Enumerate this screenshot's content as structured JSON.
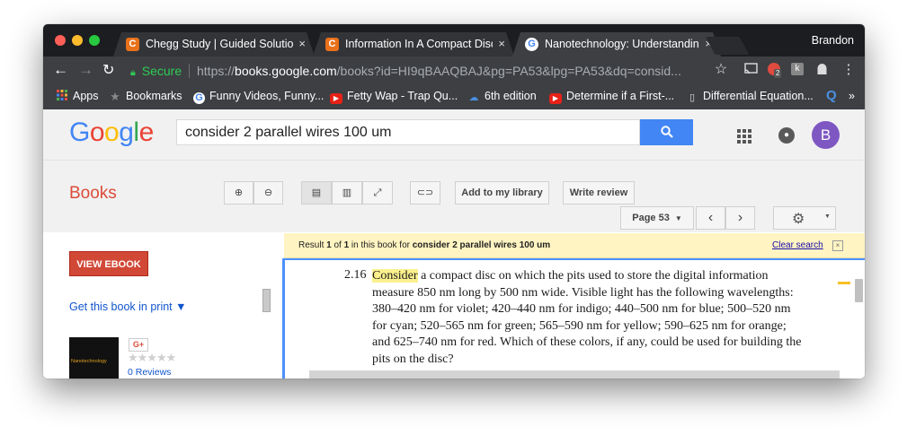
{
  "browser": {
    "tabs": [
      {
        "title": "Chegg Study | Guided Solution",
        "close": "×",
        "favicon": "C"
      },
      {
        "title": "Information In A Compact Disc",
        "close": "×",
        "favicon": "C"
      },
      {
        "title": "Nanotechnology: Understanding",
        "close": "×",
        "favicon": "G"
      }
    ],
    "profile": "Brandon",
    "secure_label": "Secure",
    "url_scheme": "https://",
    "url_host": "books.google.com",
    "url_path": "/books?id=HI9qBAAQBAJ&pg=PA53&lpg=PA53&dq=consid...",
    "icons": [
      "back-icon",
      "forward-icon",
      "reload-icon",
      "lock-icon",
      "star-icon",
      "cast-icon",
      "extension-icon",
      "extension-badge",
      "ghost-icon",
      "menu-icon"
    ],
    "extension_badge_count": "2",
    "bookmarks": [
      {
        "label": "Apps"
      },
      {
        "label": "Bookmarks"
      },
      {
        "label": "Funny Videos, Funny..."
      },
      {
        "label": "Fetty Wap - Trap Qu..."
      },
      {
        "label": "6th edition"
      },
      {
        "label": "Determine if a First-..."
      },
      {
        "label": "Differential Equation..."
      }
    ],
    "bookmarks_more": "»"
  },
  "google": {
    "logo_letters": [
      "G",
      "o",
      "o",
      "g",
      "l",
      "e"
    ],
    "logo_colors": [
      "#4285f4",
      "#ea4335",
      "#fbbc05",
      "#4285f4",
      "#34a853",
      "#ea4335"
    ],
    "search_query": "consider 2 parallel wires 100 um",
    "avatar_letter": "B"
  },
  "books": {
    "title": "Books",
    "add_library": "Add to my library",
    "write_review": "Write review",
    "page_label": "Page 53",
    "view_ebook": "VIEW EBOOK",
    "get_print": "Get this book in print ▼",
    "cover_text": "Nanotechnology",
    "gplus": "G+",
    "stars": "★★★★★",
    "rating": 0,
    "reviews": "0 Reviews"
  },
  "result": {
    "prefix": "Result ",
    "n": "1",
    "of": " of ",
    "total": "1",
    "mid": " in this book for ",
    "query": "consider 2 parallel wires 100 um",
    "clear": "Clear search",
    "close": "×"
  },
  "page": {
    "number": "2.16",
    "highlight": "Consider",
    "text": " a compact disc on which the pits used to store the digital information measure 850 nm long by 500 nm wide. Visible light has the following wavelengths: 380–420 nm for violet; 420–440 nm for indigo; 440–500 nm for blue; 500–520 nm for cyan; 520–565 nm for green; 565–590 nm for yellow; 590–625 nm for orange; and 625–740 nm for red. Which of these colors, if any, could be used for building the pits on the disc?"
  }
}
